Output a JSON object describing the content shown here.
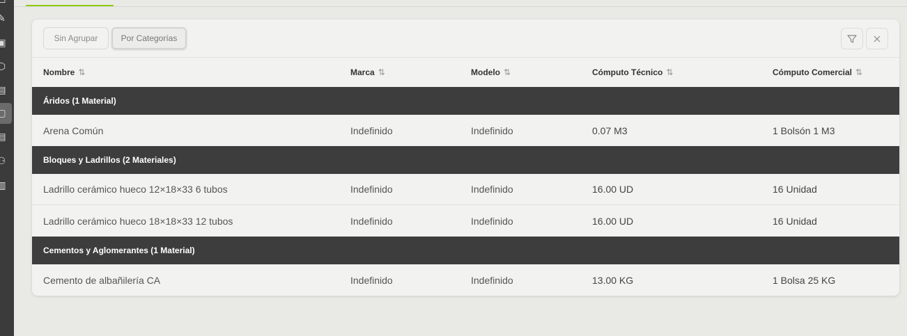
{
  "toolbar": {
    "group_none": "Sin Agrupar",
    "group_category": "Por Categorías"
  },
  "columns": [
    "Nombre",
    "Marca",
    "Modelo",
    "Cómputo Técnico",
    "Cómputo Comercial"
  ],
  "groups": [
    {
      "title": "Áridos (1 Material)",
      "rows": [
        [
          "Arena Común",
          "Indefinido",
          "Indefinido",
          "0.07 M3",
          "1 Bolsón 1 M3"
        ]
      ]
    },
    {
      "title": "Bloques y Ladrillos (2 Materiales)",
      "rows": [
        [
          "Ladrillo cerámico hueco 12×18×33 6 tubos",
          "Indefinido",
          "Indefinido",
          "16.00 UD",
          "16 Unidad"
        ],
        [
          "Ladrillo cerámico hueco 18×18×33 12 tubos",
          "Indefinido",
          "Indefinido",
          "16.00 UD",
          "16 Unidad"
        ]
      ]
    },
    {
      "title": "Cementos y Aglomerantes (1 Material)",
      "rows": [
        [
          "Cemento de albañilería CA",
          "Indefinido",
          "Indefinido",
          "13.00 KG",
          "1 Bolsa 25 KG"
        ]
      ]
    }
  ]
}
